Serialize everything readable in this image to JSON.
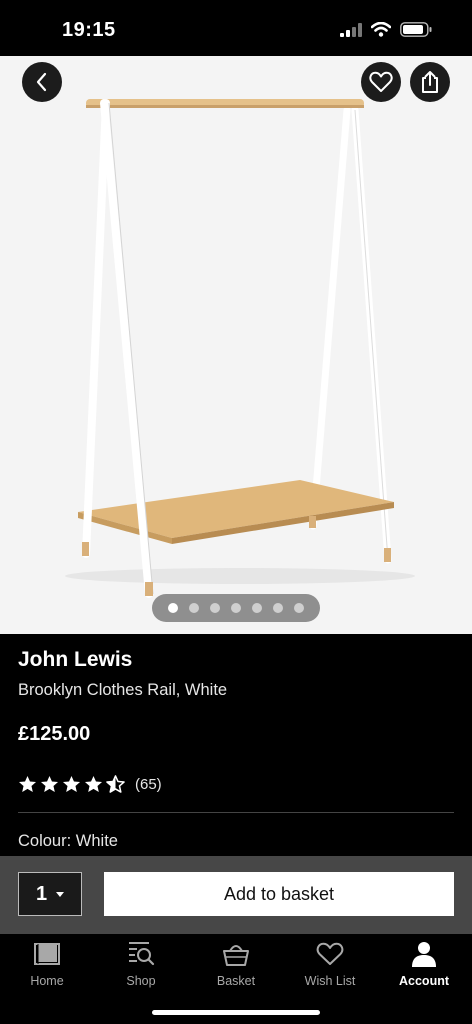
{
  "status": {
    "time": "19:15"
  },
  "product": {
    "brand": "John Lewis",
    "name": "Brooklyn Clothes Rail, White",
    "price": "£125.00",
    "rating": 4.5,
    "reviews": "(65)",
    "colour": "Colour: White",
    "image_count": 7,
    "current_image": 1
  },
  "purchase": {
    "quantity": "1",
    "add_label": "Add to basket"
  },
  "tabs": [
    {
      "label": "Home",
      "icon": "home-icon"
    },
    {
      "label": "Shop",
      "icon": "shop-search-icon"
    },
    {
      "label": "Basket",
      "icon": "basket-icon"
    },
    {
      "label": "Wish List",
      "icon": "heart-icon"
    },
    {
      "label": "Account",
      "icon": "account-icon",
      "active": true
    }
  ]
}
